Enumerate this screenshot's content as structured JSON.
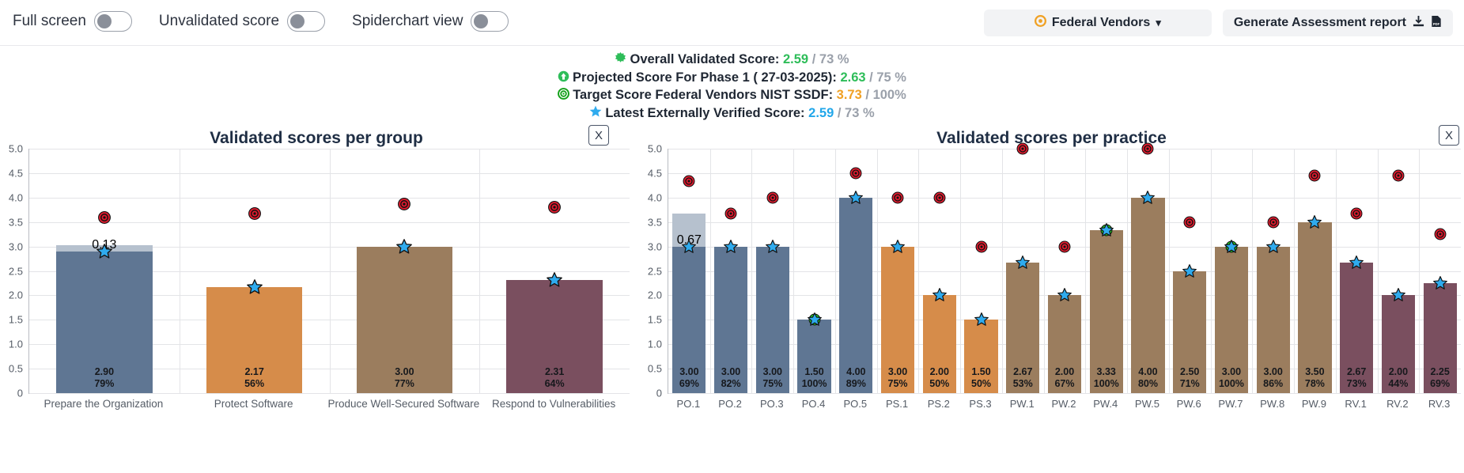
{
  "toolbar": {
    "toggles": [
      {
        "label": "Full screen",
        "name": "full-screen",
        "on": false
      },
      {
        "label": "Unvalidated score",
        "name": "unvalidated-score",
        "on": false
      },
      {
        "label": "Spiderchart view",
        "name": "spiderchart-view",
        "on": false
      }
    ],
    "vendor_select": {
      "label": "Federal Vendors",
      "icon": "target-icon",
      "chevron": "⌄"
    },
    "generate_report": {
      "label": "Generate Assessment report",
      "icons": [
        "download-icon",
        "pdf-icon"
      ]
    }
  },
  "summary": {
    "lines": [
      {
        "icon": "green-burst-icon",
        "label": "Overall Validated Score:",
        "value": "2.59",
        "value_color": "#2ebd59",
        "sep": "/",
        "pct": "73 %"
      },
      {
        "icon": "green-up-arrow-icon",
        "label": "Projected Score For Phase 1 ( 27-03-2025):",
        "value": "2.63",
        "value_color": "#2ebd59",
        "sep": "/",
        "pct": "75 %"
      },
      {
        "icon": "green-target-icon",
        "label": "Target Score Federal Vendors NIST SSDF:",
        "value": "3.73",
        "value_color": "#f0a124",
        "sep": "/",
        "pct": "100%"
      },
      {
        "icon": "blue-star-icon",
        "label": "Latest Externally Verified Score:",
        "value": "2.59",
        "value_color": "#22a7ea",
        "sep": "/",
        "pct": "73 %"
      }
    ]
  },
  "colors": {
    "group_blue": "#5f7693",
    "group_orange": "#d68c4a",
    "group_brown": "#9b7d5e",
    "group_maroon": "#7a4f5f",
    "projection": "#b6c1ce",
    "target_red": "#e01b2e",
    "target_green": "#22d126",
    "verified_star": "#2fabee"
  },
  "close_button_label": "X",
  "chart_data": [
    {
      "id": "validated-scores-per-group",
      "type": "bar",
      "title": "Validated scores per group",
      "ylim": [
        0,
        5
      ],
      "yticks": [
        "0",
        "0.5",
        "1.0",
        "1.5",
        "2.0",
        "2.5",
        "3.0",
        "3.5",
        "4.0",
        "4.5",
        "5.0"
      ],
      "ytick_values": [
        0,
        0.5,
        1.0,
        1.5,
        2.0,
        2.5,
        3.0,
        3.5,
        4.0,
        4.5,
        5.0
      ],
      "grid": true,
      "categories": [
        "Prepare the Organization",
        "Protect Software",
        "Produce Well-Secured Software",
        "Respond to Vulnerabilities"
      ],
      "values": [
        2.9,
        2.17,
        3.0,
        2.31
      ],
      "value_labels": [
        "2.90",
        "2.17",
        "3.00",
        "2.31"
      ],
      "pct_labels": [
        "79%",
        "56%",
        "77%",
        "64%"
      ],
      "bar_colors": [
        "#5f7693",
        "#d68c4a",
        "#9b7d5e",
        "#7a4f5f"
      ],
      "projection": [
        {
          "index": 0,
          "delta": 0.13,
          "top": 3.03,
          "label": "0.13"
        }
      ],
      "target_markers": [
        {
          "index": 0,
          "value": 3.6,
          "kind": "red"
        },
        {
          "index": 1,
          "value": 3.67,
          "kind": "red"
        },
        {
          "index": 2,
          "value": 3.86,
          "kind": "red"
        },
        {
          "index": 3,
          "value": 3.8,
          "kind": "red"
        }
      ],
      "verified_markers": [
        {
          "index": 0,
          "value": 2.9
        },
        {
          "index": 1,
          "value": 2.17
        },
        {
          "index": 2,
          "value": 3.0
        },
        {
          "index": 3,
          "value": 2.31
        }
      ]
    },
    {
      "id": "validated-scores-per-practice",
      "type": "bar",
      "title": "Validated scores per practice",
      "ylim": [
        0,
        5
      ],
      "yticks": [
        "0",
        "0.5",
        "1.0",
        "1.5",
        "2.0",
        "2.5",
        "3.0",
        "3.5",
        "4.0",
        "4.5",
        "5.0"
      ],
      "ytick_values": [
        0,
        0.5,
        1.0,
        1.5,
        2.0,
        2.5,
        3.0,
        3.5,
        4.0,
        4.5,
        5.0
      ],
      "grid": true,
      "categories": [
        "PO.1",
        "PO.2",
        "PO.3",
        "PO.4",
        "PO.5",
        "PS.1",
        "PS.2",
        "PS.3",
        "PW.1",
        "PW.2",
        "PW.4",
        "PW.5",
        "PW.6",
        "PW.7",
        "PW.8",
        "PW.9",
        "RV.1",
        "RV.2",
        "RV.3"
      ],
      "values": [
        3.0,
        3.0,
        3.0,
        1.5,
        4.0,
        3.0,
        2.0,
        1.5,
        2.67,
        2.0,
        3.33,
        4.0,
        2.5,
        3.0,
        3.0,
        3.5,
        2.67,
        2.0,
        2.25
      ],
      "value_labels": [
        "3.00",
        "3.00",
        "3.00",
        "1.50",
        "4.00",
        "3.00",
        "2.00",
        "1.50",
        "2.67",
        "2.00",
        "3.33",
        "4.00",
        "2.50",
        "3.00",
        "3.00",
        "3.50",
        "2.67",
        "2.00",
        "2.25"
      ],
      "pct_labels": [
        "69%",
        "82%",
        "75%",
        "100%",
        "89%",
        "75%",
        "50%",
        "50%",
        "53%",
        "67%",
        "100%",
        "80%",
        "71%",
        "100%",
        "86%",
        "78%",
        "73%",
        "44%",
        "69%"
      ],
      "bar_colors": [
        "#5f7693",
        "#5f7693",
        "#5f7693",
        "#5f7693",
        "#5f7693",
        "#d68c4a",
        "#d68c4a",
        "#d68c4a",
        "#9b7d5e",
        "#9b7d5e",
        "#9b7d5e",
        "#9b7d5e",
        "#9b7d5e",
        "#9b7d5e",
        "#9b7d5e",
        "#9b7d5e",
        "#7a4f5f",
        "#7a4f5f",
        "#7a4f5f"
      ],
      "projection": [
        {
          "index": 0,
          "delta": 0.67,
          "top": 3.67,
          "label": "0.67"
        }
      ],
      "target_markers": [
        {
          "index": 0,
          "value": 4.33,
          "kind": "red"
        },
        {
          "index": 1,
          "value": 3.67,
          "kind": "red"
        },
        {
          "index": 2,
          "value": 4.0,
          "kind": "red"
        },
        {
          "index": 3,
          "value": 1.5,
          "kind": "green"
        },
        {
          "index": 4,
          "value": 4.5,
          "kind": "red"
        },
        {
          "index": 5,
          "value": 4.0,
          "kind": "red"
        },
        {
          "index": 6,
          "value": 4.0,
          "kind": "red"
        },
        {
          "index": 7,
          "value": 3.0,
          "kind": "red"
        },
        {
          "index": 8,
          "value": 5.0,
          "kind": "red"
        },
        {
          "index": 9,
          "value": 3.0,
          "kind": "red"
        },
        {
          "index": 10,
          "value": 3.33,
          "kind": "green"
        },
        {
          "index": 11,
          "value": 5.0,
          "kind": "red"
        },
        {
          "index": 12,
          "value": 3.5,
          "kind": "red"
        },
        {
          "index": 13,
          "value": 3.0,
          "kind": "green"
        },
        {
          "index": 14,
          "value": 3.5,
          "kind": "red"
        },
        {
          "index": 15,
          "value": 4.45,
          "kind": "red"
        },
        {
          "index": 16,
          "value": 3.67,
          "kind": "red"
        },
        {
          "index": 17,
          "value": 4.45,
          "kind": "red"
        },
        {
          "index": 18,
          "value": 3.25,
          "kind": "red"
        }
      ],
      "verified_markers": [
        {
          "index": 0,
          "value": 3.0
        },
        {
          "index": 1,
          "value": 3.0
        },
        {
          "index": 2,
          "value": 3.0
        },
        {
          "index": 3,
          "value": 1.5
        },
        {
          "index": 4,
          "value": 4.0
        },
        {
          "index": 5,
          "value": 3.0
        },
        {
          "index": 6,
          "value": 2.0
        },
        {
          "index": 7,
          "value": 1.5
        },
        {
          "index": 8,
          "value": 2.67
        },
        {
          "index": 9,
          "value": 2.0
        },
        {
          "index": 10,
          "value": 3.33
        },
        {
          "index": 11,
          "value": 4.0
        },
        {
          "index": 12,
          "value": 2.5
        },
        {
          "index": 13,
          "value": 3.0
        },
        {
          "index": 14,
          "value": 3.0
        },
        {
          "index": 15,
          "value": 3.5
        },
        {
          "index": 16,
          "value": 2.67
        },
        {
          "index": 17,
          "value": 2.0
        },
        {
          "index": 18,
          "value": 2.25
        }
      ]
    }
  ]
}
